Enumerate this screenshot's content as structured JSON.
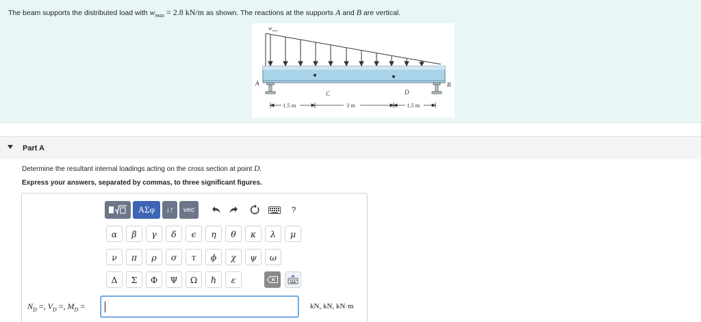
{
  "problem": {
    "text_before": "The beam supports the distributed load with ",
    "w_symbol": "w",
    "w_subscript": "max",
    "equals_value": " = 2.8 ",
    "units": "kN/m",
    "text_middle": " as shown. The reactions at the supports ",
    "point_a": "A",
    "text_and": " and ",
    "point_b": "B",
    "text_end": " are vertical.",
    "figure": {
      "load_label": "w",
      "load_label_sub": "max",
      "point_labels": [
        "A",
        "C",
        "D",
        "B"
      ],
      "dimensions": [
        "1.5 m",
        "3 m",
        "1.5 m"
      ]
    }
  },
  "part": {
    "title": "Part A",
    "expanded": true
  },
  "instructions": {
    "line1_text": "Determine the resultant internal loadings acting on the cross section at point ",
    "line1_point": "D",
    "line1_end": ".",
    "line2": "Express your answers, separated by commas, to three significant figures."
  },
  "toolbar": {
    "templates_icon": "templates-icon",
    "greek_label": "ΑΣφ",
    "arrows_label": "↓↑",
    "vec_label": "vec",
    "undo_icon": "undo-icon",
    "redo_icon": "redo-icon",
    "reset_icon": "reset-icon",
    "keyboard_icon": "keyboard-icon",
    "help_label": "?"
  },
  "greek_rows": [
    [
      "α",
      "β",
      "γ",
      "δ",
      "ϵ",
      "η",
      "θ",
      "κ",
      "λ",
      "μ"
    ],
    [
      "ν",
      "π",
      "ρ",
      "σ",
      "τ",
      "ϕ",
      "χ",
      "ψ",
      "ω"
    ],
    [
      "Δ",
      "Σ",
      "Φ",
      "Ψ",
      "Ω",
      "ℏ",
      "ε"
    ]
  ],
  "answer": {
    "label": "N",
    "label_full": "N_D =, V_D =, M_D =",
    "value": "",
    "units": "kN, kN, kN·m"
  },
  "colors": {
    "problem_bg": "#e8f6f6",
    "beam_fill": "#a9d4ea",
    "greek_button": "#3e64b4",
    "toolbar_button": "#6b7788",
    "input_border": "#4a90d9"
  }
}
